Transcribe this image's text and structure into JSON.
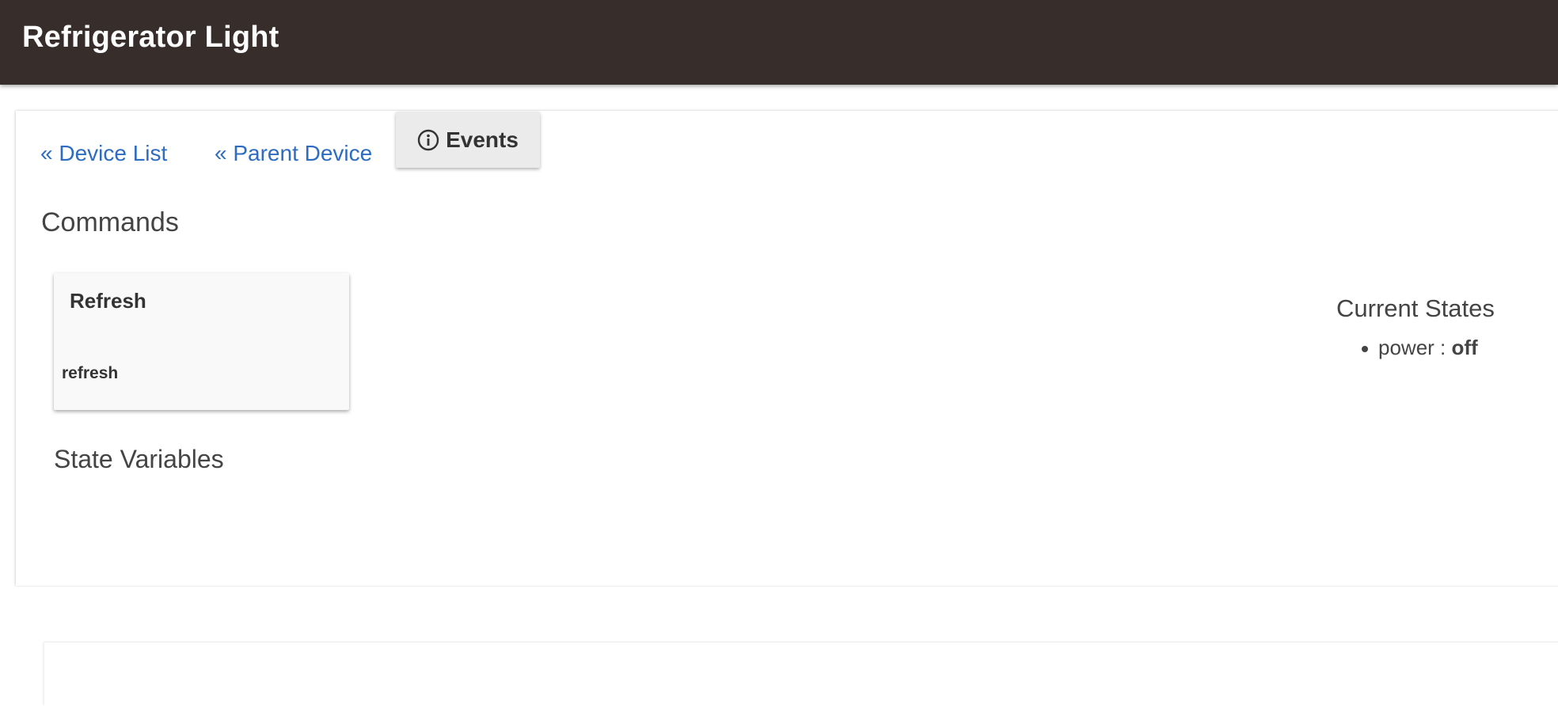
{
  "header": {
    "title": "Refrigerator Light",
    "bg_color": "#372d2b"
  },
  "nav": {
    "device_list_label": "« Device List",
    "parent_device_label": "« Parent Device",
    "events_label": "Events",
    "events_icon": "info-circle-icon",
    "link_color": "#2d6cc0"
  },
  "commands": {
    "title": "Commands",
    "items": [
      {
        "name": "Refresh",
        "method": "refresh"
      }
    ]
  },
  "state_variables": {
    "title": "State Variables"
  },
  "current_states": {
    "title": "Current States",
    "items": [
      {
        "name": "power",
        "separator": " : ",
        "value": "off"
      }
    ]
  }
}
